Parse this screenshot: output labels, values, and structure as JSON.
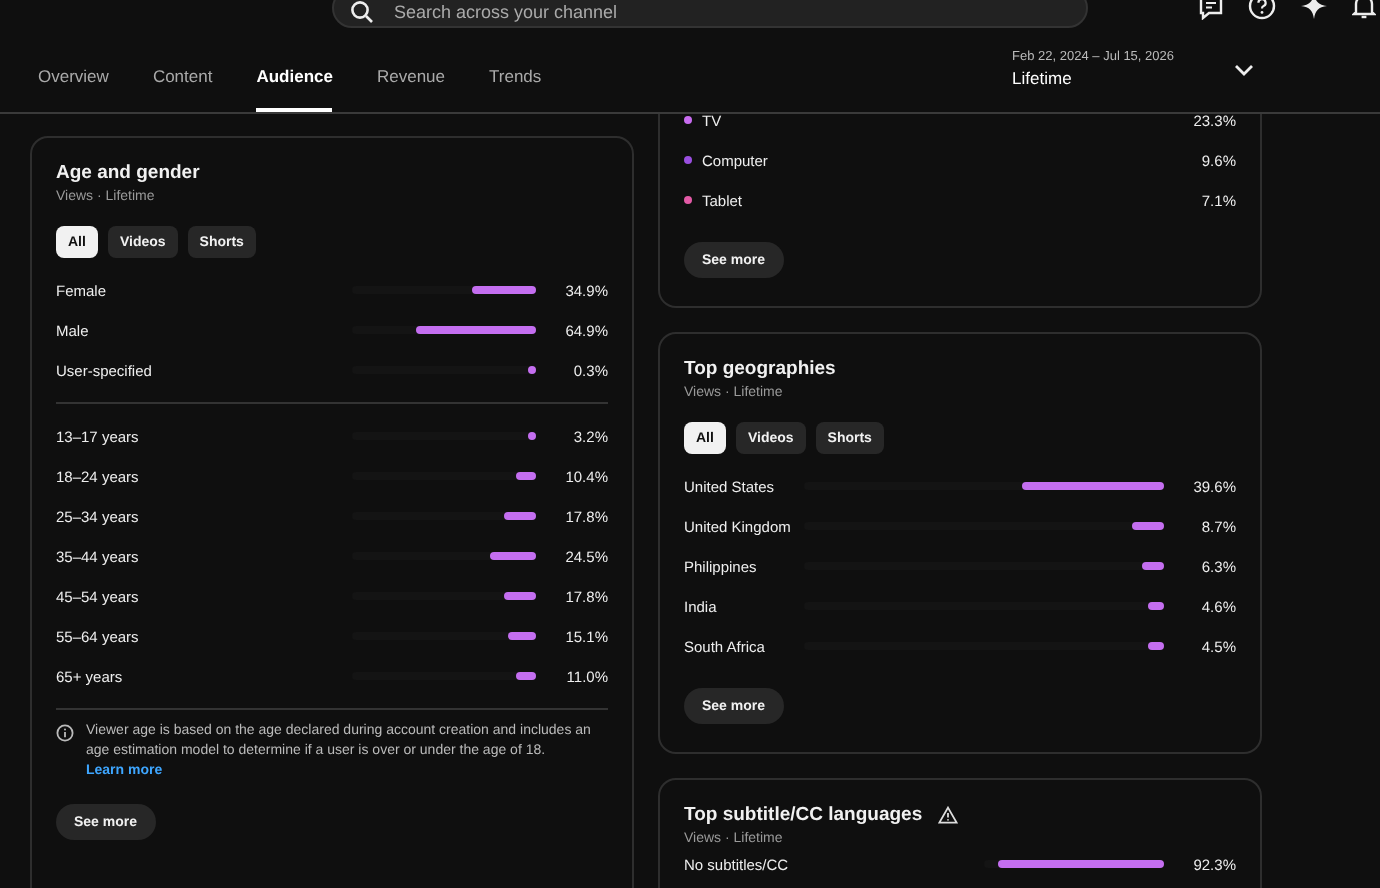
{
  "search": {
    "placeholder": "Search across your channel"
  },
  "tabs": [
    {
      "label": "Overview",
      "selected": false
    },
    {
      "label": "Content",
      "selected": false
    },
    {
      "label": "Audience",
      "selected": true
    },
    {
      "label": "Revenue",
      "selected": false
    },
    {
      "label": "Trends",
      "selected": false
    }
  ],
  "date_range": {
    "dates": "Feb 22, 2024 – Jul 15, 2026",
    "period": "Lifetime"
  },
  "age_gender": {
    "title": "Age and gender",
    "subtitle": "Views · Lifetime",
    "filters": [
      {
        "label": "All",
        "selected": true
      },
      {
        "label": "Videos",
        "selected": false
      },
      {
        "label": "Shorts",
        "selected": false
      }
    ],
    "gender": [
      {
        "label": "Female",
        "level": 0.349,
        "value": "34.9%"
      },
      {
        "label": "Male",
        "level": 0.649,
        "value": "64.9%"
      },
      {
        "label": "User-specified",
        "level": 0.003,
        "value": "0.3%"
      }
    ],
    "ages": [
      {
        "label": "13–17 years",
        "level": 0.032,
        "value": "3.2%"
      },
      {
        "label": "18–24 years",
        "level": 0.104,
        "value": "10.4%"
      },
      {
        "label": "25–34 years",
        "level": 0.178,
        "value": "17.8%"
      },
      {
        "label": "35–44 years",
        "level": 0.245,
        "value": "24.5%"
      },
      {
        "label": "45–54 years",
        "level": 0.178,
        "value": "17.8%"
      },
      {
        "label": "55–64 years",
        "level": 0.151,
        "value": "15.1%"
      },
      {
        "label": "65+ years",
        "level": 0.11,
        "value": "11.0%"
      }
    ],
    "note": "Viewer age is based on the age declared during account creation and includes an age estimation model to determine if a user is over or under the age of 18.",
    "link": "Learn more",
    "button": "See more"
  },
  "devices": {
    "items": [
      {
        "label": "TV",
        "value": "23.3%",
        "color": "#c86cf0"
      },
      {
        "label": "Computer",
        "value": "9.6%",
        "color": "#9a4fe0"
      },
      {
        "label": "Tablet",
        "value": "7.1%",
        "color": "#e35aa6"
      }
    ],
    "button": "See more"
  },
  "geographies": {
    "title": "Top geographies",
    "subtitle": "Views · Lifetime",
    "filters": [
      {
        "label": "All",
        "selected": true
      },
      {
        "label": "Videos",
        "selected": false
      },
      {
        "label": "Shorts",
        "selected": false
      }
    ],
    "rows": [
      {
        "label": "United States",
        "level": 0.396,
        "value": "39.6%"
      },
      {
        "label": "United Kingdom",
        "level": 0.087,
        "value": "8.7%"
      },
      {
        "label": "Philippines",
        "level": 0.063,
        "value": "6.3%"
      },
      {
        "label": "India",
        "level": 0.046,
        "value": "4.6%"
      },
      {
        "label": "South Africa",
        "level": 0.045,
        "value": "4.5%"
      }
    ],
    "button": "See more"
  },
  "subtitles": {
    "title": "Top subtitle/CC languages",
    "subtitle": "Views · Lifetime",
    "rows": [
      {
        "label": "No subtitles/CC",
        "level": 0.923,
        "value": "92.3%"
      }
    ]
  }
}
